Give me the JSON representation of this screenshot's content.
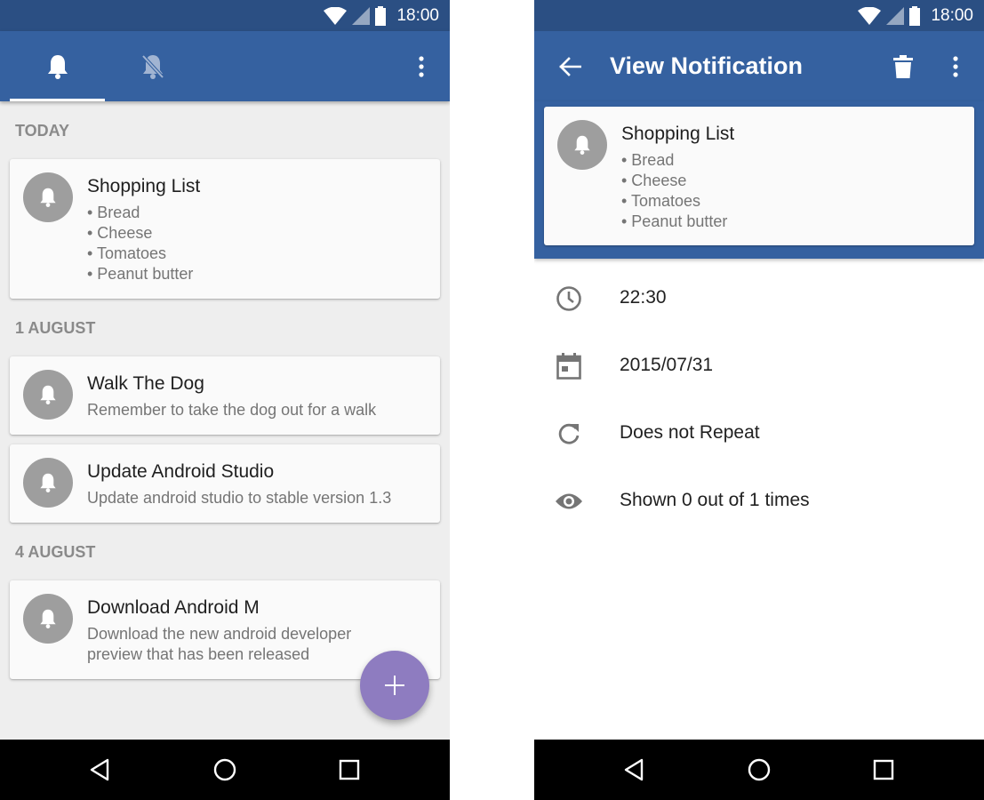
{
  "status_bar": {
    "time": "18:00"
  },
  "left_screen": {
    "tabs": [
      {
        "icon": "bell-icon",
        "active": true
      },
      {
        "icon": "bell-off-icon",
        "active": false
      }
    ],
    "sections": [
      {
        "header": "TODAY",
        "cards": [
          {
            "title": "Shopping List",
            "lines": [
              "• Bread",
              "• Cheese",
              "• Tomatoes",
              "• Peanut butter"
            ]
          }
        ]
      },
      {
        "header": "1 AUGUST",
        "cards": [
          {
            "title": "Walk The Dog",
            "lines": [
              "Remember to take the dog out for a walk"
            ]
          },
          {
            "title": "Update Android Studio",
            "lines": [
              "Update android studio to stable version 1.3"
            ]
          }
        ]
      },
      {
        "header": "4 AUGUST",
        "cards": [
          {
            "title": "Download Android M",
            "lines": [
              "Download the new android developer",
              "preview that has been released"
            ]
          }
        ]
      }
    ],
    "fab_icon": "plus-icon"
  },
  "right_screen": {
    "title": "View Notification",
    "notification": {
      "title": "Shopping List",
      "lines": [
        "• Bread",
        "• Cheese",
        "• Tomatoes",
        "• Peanut butter"
      ]
    },
    "details": [
      {
        "icon": "clock-icon",
        "text": "22:30"
      },
      {
        "icon": "calendar-icon",
        "text": "2015/07/31"
      },
      {
        "icon": "repeat-icon",
        "text": "Does not Repeat"
      },
      {
        "icon": "eye-icon",
        "text": "Shown 0 out of 1 times"
      }
    ]
  },
  "colors": {
    "status_bar": "#2b4f83",
    "app_bar": "#3561a0",
    "fab": "#8e7cc0",
    "avatar": "#9e9e9e",
    "section_header": "#8a8a8a"
  }
}
